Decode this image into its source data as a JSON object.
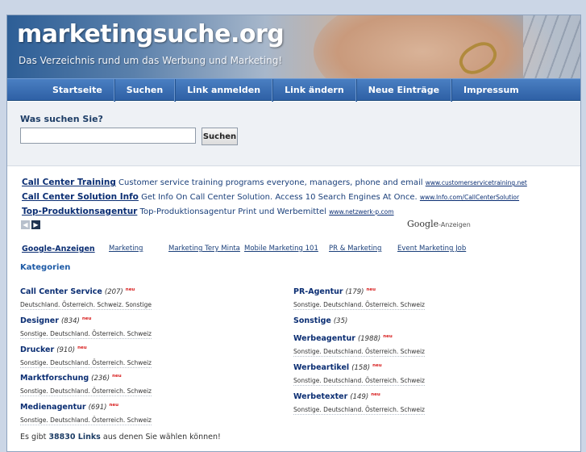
{
  "header": {
    "title": "marketingsuche.org",
    "tagline": "Das Verzeichnis rund um das Werbung und Marketing!"
  },
  "nav": {
    "items": [
      {
        "label": "Startseite"
      },
      {
        "label": "Suchen"
      },
      {
        "label": "Link anmelden"
      },
      {
        "label": "Link ändern"
      },
      {
        "label": "Neue Einträge"
      },
      {
        "label": "Impressum"
      }
    ]
  },
  "search": {
    "label": "Was suchen Sie?",
    "input_value": "",
    "placeholder": "",
    "button_label": "Suchen"
  },
  "ads": [
    {
      "title": "Call Center Training",
      "text": "Customer service training programs everyone, managers, phone and email",
      "url": "www.customerservicetraining.net"
    },
    {
      "title": "Call Center Solution Info",
      "text": "Get Info On Call Center Solution. Access 10 Search Engines At Once.",
      "url": "www.Info.com/CallCenterSolutior"
    },
    {
      "title": "Top-Produktionsagentur",
      "text": "Top-Produktionsagentur Print und Werbemittel",
      "url": "www.netzwerk-p.com"
    }
  ],
  "ad_nav": {
    "prev": "◀",
    "next": "▶"
  },
  "google_badge": {
    "logo": "Google",
    "suffix": "-Anzeigen"
  },
  "links_row": {
    "first": "Google-Anzeigen",
    "items": [
      "Marketing",
      "Marketing Tery Minta",
      "Mobile Marketing 101",
      "PR & Marketing",
      "Event Marketing Job"
    ]
  },
  "categories_heading": "Kategorien",
  "new_badge": "neu",
  "categories_left": [
    {
      "name": "Call Center Service",
      "count": "(207)",
      "new": true,
      "sub": "Deutschland. Österreich. Schweiz. Sonstige"
    },
    {
      "name": "Designer",
      "count": "(834)",
      "new": true,
      "sub": "Sonstige. Deutschland. Österreich. Schweiz"
    },
    {
      "name": "Drucker",
      "count": "(910)",
      "new": true,
      "sub": "Sonstige. Deutschland. Österreich. Schweiz"
    },
    {
      "name": "Marktforschung",
      "count": "(236)",
      "new": true,
      "sub": "Sonstige. Deutschland. Österreich. Schweiz"
    },
    {
      "name": "Medienagentur",
      "count": "(691)",
      "new": true,
      "sub": "Sonstige. Deutschland. Österreich. Schweiz"
    }
  ],
  "categories_right": [
    {
      "name": "PR-Agentur",
      "count": "(179)",
      "new": true,
      "sub": "Sonstige. Deutschland. Österreich. Schweiz"
    },
    {
      "name": "Sonstige",
      "count": "(35)",
      "new": false,
      "sub": ""
    },
    {
      "name": "Werbeagentur",
      "count": "(1988)",
      "new": true,
      "sub": "Sonstige. Deutschland. Österreich. Schweiz"
    },
    {
      "name": "Werbeartikel",
      "count": "(158)",
      "new": true,
      "sub": "Sonstige. Deutschland. Österreich. Schweiz"
    },
    {
      "name": "Werbetexter",
      "count": "(149)",
      "new": true,
      "sub": "Sonstige. Deutschland. Österreich. Schweiz"
    }
  ],
  "footer": {
    "prefix": "Es gibt",
    "count": "38830 Links",
    "suffix": "aus denen Sie wählen können!"
  },
  "colors": {
    "nav_bg": "#2e60a5",
    "link": "#0b2e73",
    "new_badge": "#d81e1e",
    "page_bg": "#cbd6e6"
  }
}
